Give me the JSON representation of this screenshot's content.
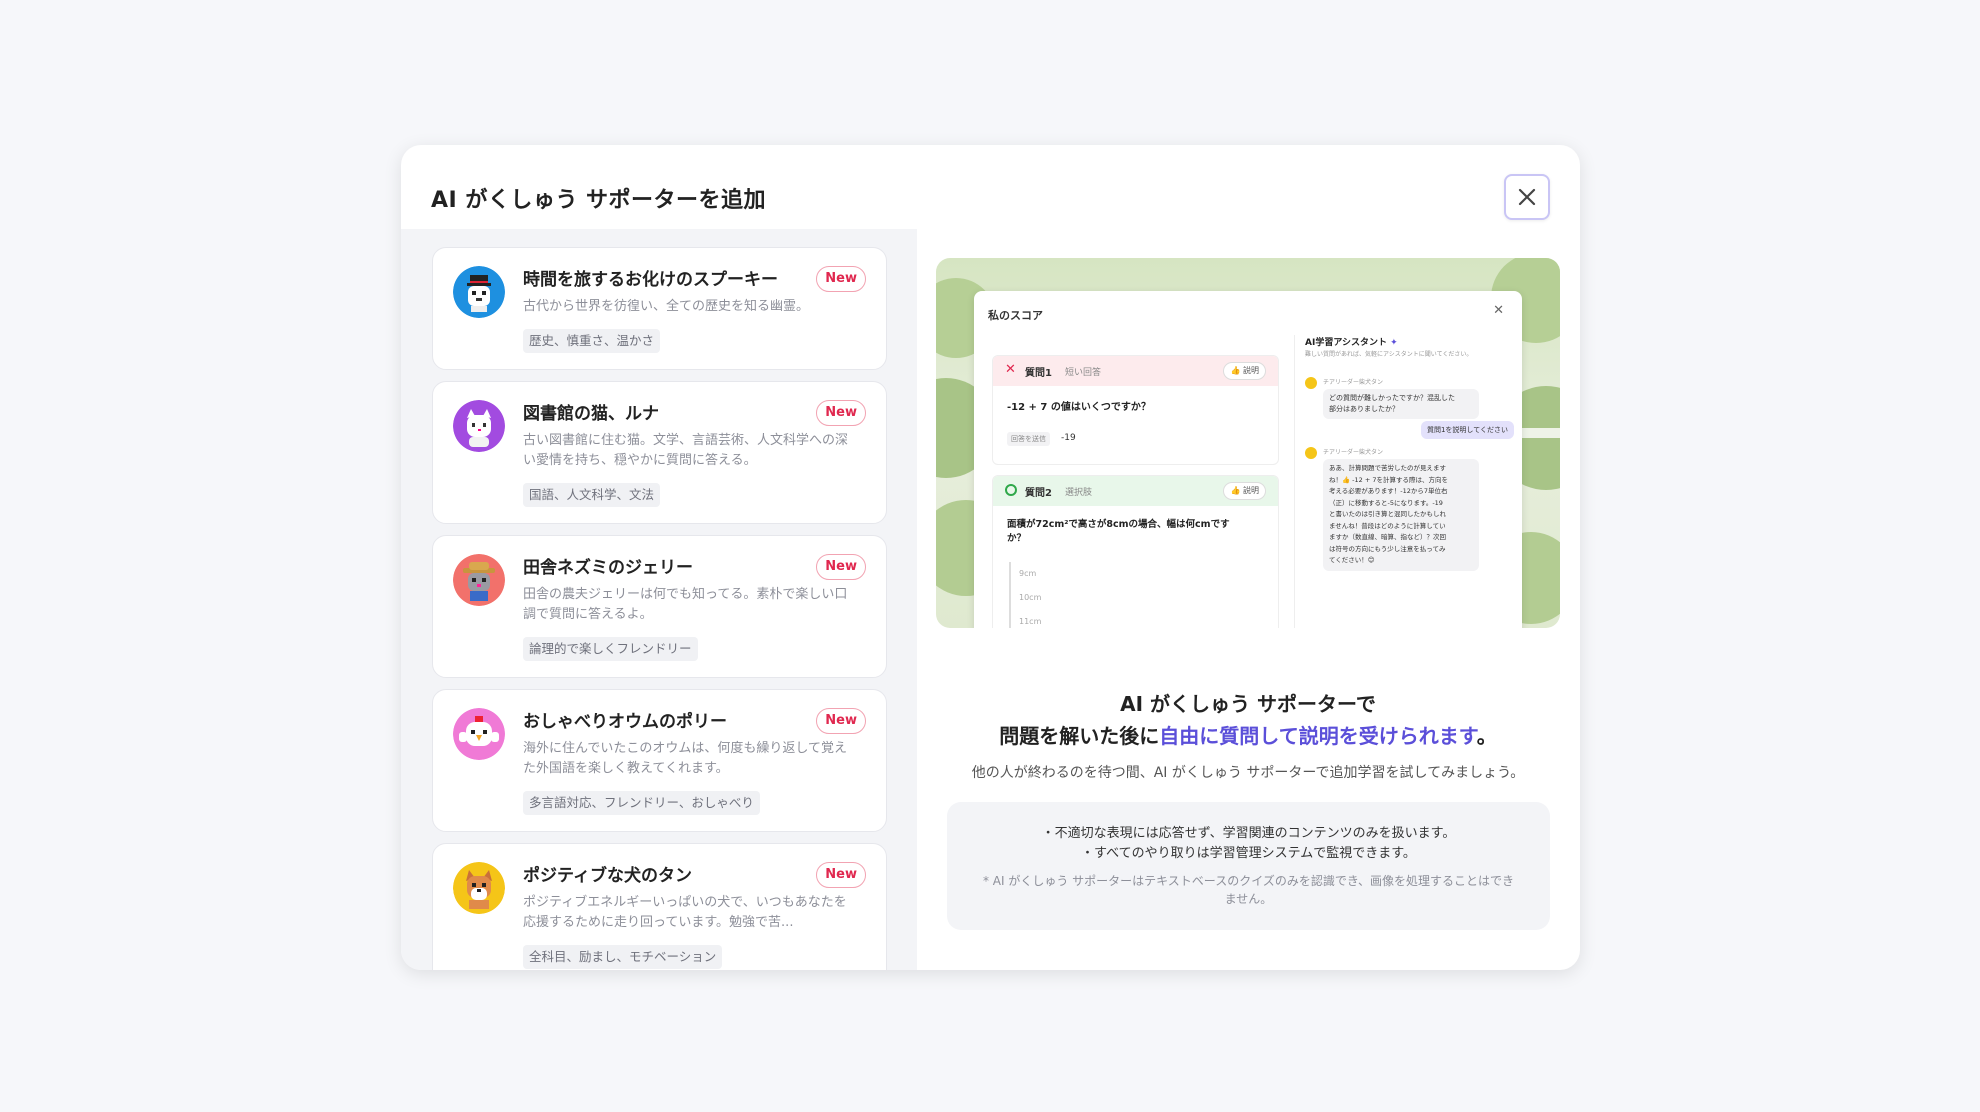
{
  "modal": {
    "title": "AI がくしゅう サポーターを追加",
    "close_label": "×"
  },
  "characters": [
    {
      "name": "時間を旅するお化けのスプーキー",
      "badge": "New",
      "description": "古代から世界を彷徨い、全ての歴史を知る幽霊。",
      "tags": "歴史、慎重さ、温かさ",
      "avatar_bg": "#1e90e0"
    },
    {
      "name": "図書館の猫、ルナ",
      "badge": "New",
      "description": "古い図書館に住む猫。文学、言語芸術、人文科学への深い愛情を持ち、穏やかに質問に答える。",
      "tags": "国語、人文科学、文法",
      "avatar_bg": "#a24be0"
    },
    {
      "name": "田舎ネズミのジェリー",
      "badge": "New",
      "description": "田舎の農夫ジェリーは何でも知ってる。素朴で楽しい口調で質問に答えるよ。",
      "tags": "論理的で楽しくフレンドリー",
      "avatar_bg": "#f2716b"
    },
    {
      "name": "おしゃべりオウムのポリー",
      "badge": "New",
      "description": "海外に住んでいたこのオウムは、何度も繰り返して覚えた外国語を楽しく教えてくれます。",
      "tags": "多言語対応、フレンドリー、おしゃべり",
      "avatar_bg": "#f07ad6"
    },
    {
      "name": "ポジティブな犬のタン",
      "badge": "New",
      "description": "ポジティブエネルギーいっぱいの犬で、いつもあなたを応援するために走り回っています。勉強で苦...",
      "tags": "全科目、励まし、モチベーション",
      "avatar_bg": "#f5c518"
    }
  ],
  "preview": {
    "score_title": "私のスコア",
    "q1_label": "質問1",
    "q1_type": "短い回答",
    "q1_explain": "説明",
    "q1_text": "-12 + 7 の値はいくつですか？",
    "q1_answer_label": "回答を送信",
    "q1_answer": "-19",
    "q2_label": "質問2",
    "q2_type": "選択肢",
    "q2_explain": "説明",
    "q2_text_1": "面積が72cm²で高さが8cmの場合、幅は何cmです",
    "q2_text_2": "か？",
    "q2_options": [
      "9cm",
      "10cm",
      "11cm"
    ],
    "assistant_title": "AI学習アシスタント",
    "assistant_sub": "難しい質問があれば、気軽にアシスタントに聞いてください。",
    "bot_name": "チアリーダー柴犬タン",
    "bot_msg_1_l1": "どの質問が難しかったですか？混乱した",
    "bot_msg_1_l2": "部分はありましたか？",
    "user_msg": "質問1を説明してください",
    "bot_msg_2": [
      "ああ、計算問題で苦労したのが見えます",
      "ね！👍 -12 + 7を計算する際は、方向を",
      "考える必要があります！-12から7単位右",
      "（正）に移動すると-5になります。-19",
      "と書いたのは引き算と混同したかもしれ",
      "ませんね！普段はどのように計算してい",
      "ますか（数直線、暗算、指など）？次回",
      "は符号の方向にもう少し注意を払ってみ",
      "てください！😊"
    ]
  },
  "headline": {
    "line1": "AI がくしゅう サポーターで",
    "line2_pre": "問題を解いた後に",
    "line2_accent": "自由に質問して説明を受けられます",
    "line2_post": "。"
  },
  "subline": "他の人が終わるのを待つ間、AI がくしゅう サポーターで追加学習を試してみましょう。",
  "notice": {
    "bullets": [
      "・不適切な表現には応答せず、学習関連のコンテンツのみを扱います。",
      "・すべてのやり取りは学習管理システムで監視できます。"
    ],
    "footnote": "* AI がくしゅう サポーターはテキストベースのクイズのみを認識でき、画像を処理することはできません。"
  },
  "colors": {
    "accent": "#5b4fd9",
    "new_badge": "#e0284f",
    "close_border": "#c9c5f5"
  }
}
